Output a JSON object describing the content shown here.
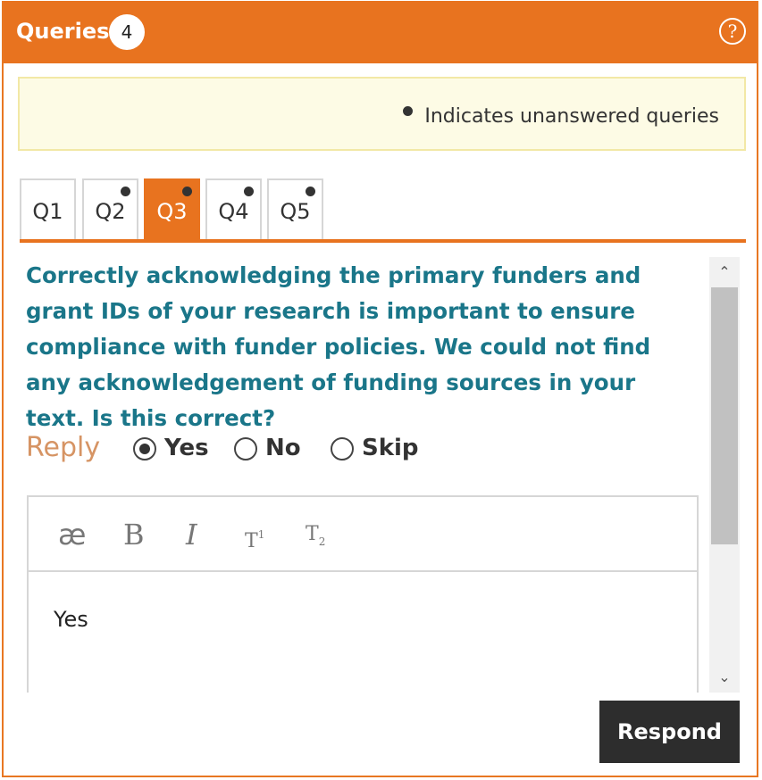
{
  "header": {
    "title": "Queries",
    "count": "4",
    "help_symbol": "?",
    "color": "#e8731f"
  },
  "legend": {
    "text": "Indicates unanswered queries"
  },
  "tabs": [
    {
      "label": "Q1",
      "unanswered": false,
      "active": false
    },
    {
      "label": "Q2",
      "unanswered": true,
      "active": false
    },
    {
      "label": "Q3",
      "unanswered": true,
      "active": true
    },
    {
      "label": "Q4",
      "unanswered": true,
      "active": false
    },
    {
      "label": "Q5",
      "unanswered": true,
      "active": false
    }
  ],
  "query": {
    "text": "Correctly acknowledging the primary funders and grant IDs of your research is important to ensure compliance with funder policies. We could not find any acknowledgement of funding sources in your text. Is this correct?",
    "text_color": "#1a7689"
  },
  "reply": {
    "label": "Reply",
    "options": [
      {
        "label": "Yes",
        "checked": true
      },
      {
        "label": "No",
        "checked": false
      },
      {
        "label": "Skip",
        "checked": false
      }
    ]
  },
  "editor": {
    "tools": [
      {
        "name": "ae-ligature",
        "glyph": "æ"
      },
      {
        "name": "bold",
        "glyph": "B"
      },
      {
        "name": "italic",
        "glyph": "I"
      },
      {
        "name": "superscript",
        "glyph": "T",
        "mark": "1"
      },
      {
        "name": "subscript",
        "glyph": "T",
        "mark": "2"
      }
    ],
    "text": "Yes"
  },
  "scrollbar": {
    "up_arrow": "⌃",
    "down_arrow": "⌄"
  },
  "actions": {
    "respond_label": "Respond"
  }
}
